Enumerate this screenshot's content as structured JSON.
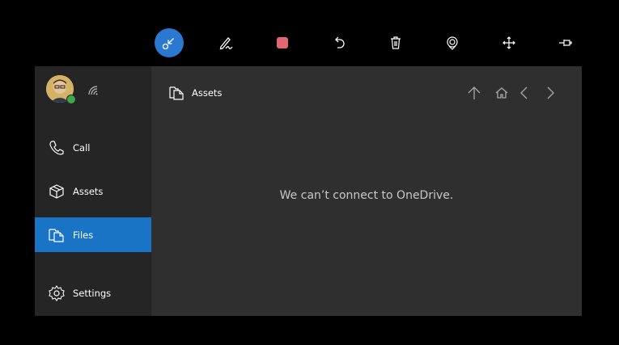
{
  "toolbar": {
    "buttons": [
      {
        "name": "collapse-icon"
      },
      {
        "name": "pen-icon"
      },
      {
        "name": "stop-icon"
      },
      {
        "name": "undo-icon"
      },
      {
        "name": "trash-icon"
      },
      {
        "name": "location-icon"
      },
      {
        "name": "move-icon"
      },
      {
        "name": "pin-icon"
      }
    ],
    "active_color": "#2b78d0",
    "stop_color": "#e0666f"
  },
  "sidebar": {
    "items": [
      {
        "label": "Call",
        "icon": "phone-icon"
      },
      {
        "label": "Assets",
        "icon": "assets-icon"
      },
      {
        "label": "Files",
        "icon": "files-icon",
        "selected": true
      },
      {
        "label": "Settings",
        "icon": "gear-icon"
      }
    ],
    "selected_color": "#1a74c6"
  },
  "content": {
    "breadcrumb": "Assets",
    "message": "We can’t connect to OneDrive."
  }
}
